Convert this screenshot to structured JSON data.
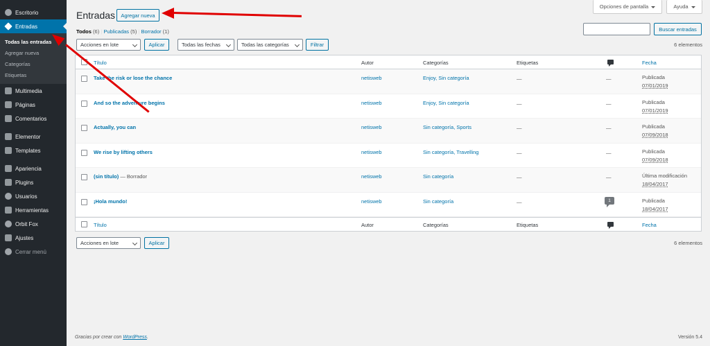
{
  "sidebar": {
    "items": [
      {
        "label": "Escritorio",
        "icon": "dashboard-icon"
      },
      {
        "label": "Entradas",
        "icon": "pin-icon",
        "active": true
      },
      {
        "label": "Multimedia",
        "icon": "media-icon"
      },
      {
        "label": "Páginas",
        "icon": "pages-icon"
      },
      {
        "label": "Comentarios",
        "icon": "comments-icon"
      },
      {
        "label": "Elementor",
        "icon": "elementor-icon"
      },
      {
        "label": "Templates",
        "icon": "templates-icon"
      },
      {
        "label": "Apariencia",
        "icon": "brush-icon"
      },
      {
        "label": "Plugins",
        "icon": "plugin-icon"
      },
      {
        "label": "Usuarios",
        "icon": "users-icon"
      },
      {
        "label": "Herramientas",
        "icon": "wrench-icon"
      },
      {
        "label": "Orbit Fox",
        "icon": "fox-icon"
      },
      {
        "label": "Ajustes",
        "icon": "settings-icon"
      },
      {
        "label": "Cerrar menú",
        "icon": "collapse-icon"
      }
    ],
    "submenu": [
      "Todas las entradas",
      "Agregar nueva",
      "Categorías",
      "Etiquetas"
    ]
  },
  "top": {
    "screen_options": "Opciones de pantalla",
    "help": "Ayuda"
  },
  "page": {
    "title": "Entradas",
    "add_new": "Agregar nueva"
  },
  "filters": {
    "all": "Todos",
    "all_count": "(6)",
    "published": "Publicadas",
    "published_count": "(5)",
    "draft": "Borrador",
    "draft_count": "(1)",
    "sep": "|"
  },
  "search": {
    "value": "",
    "button": "Buscar entradas"
  },
  "bulk": {
    "select": "Acciones en lote",
    "apply": "Aplicar"
  },
  "dates": {
    "select": "Todas las fechas"
  },
  "cats": {
    "select": "Todas las categorías"
  },
  "filter_button": "Filtrar",
  "count_label": "6 elementos",
  "columns": {
    "title": "Título",
    "author": "Autor",
    "categories": "Categorías",
    "tags": "Etiquetas",
    "date": "Fecha"
  },
  "rows": [
    {
      "title": "Take the risk or lose the chance",
      "suffix": "",
      "author": "netisweb",
      "categories": "Enjoy, Sin categoría",
      "tags": "—",
      "comments": "—",
      "status": "Publicada",
      "date": "07/01/2019"
    },
    {
      "title": "And so the adventure begins",
      "suffix": "",
      "author": "netisweb",
      "categories": "Enjoy, Sin categoría",
      "tags": "—",
      "comments": "—",
      "status": "Publicada",
      "date": "07/01/2019"
    },
    {
      "title": "Actually, you can",
      "suffix": "",
      "author": "netisweb",
      "categories": "Sin categoría, Sports",
      "tags": "—",
      "comments": "—",
      "status": "Publicada",
      "date": "07/09/2018"
    },
    {
      "title": "We rise by lifting others",
      "suffix": "",
      "author": "netisweb",
      "categories": "Sin categoría, Travelling",
      "tags": "—",
      "comments": "—",
      "status": "Publicada",
      "date": "07/09/2018"
    },
    {
      "title": "(sin título)",
      "suffix": " — Borrador",
      "author": "netisweb",
      "categories": "Sin categoría",
      "tags": "—",
      "comments": "—",
      "status": "Última modificación",
      "date": "18/04/2017"
    },
    {
      "title": "¡Hola mundo!",
      "suffix": "",
      "author": "netisweb",
      "categories": "Sin categoría",
      "tags": "—",
      "comments": "1",
      "status": "Publicada",
      "date": "18/04/2017"
    }
  ],
  "footer": {
    "thanks": "Gracias por crear con ",
    "wp": "WordPress",
    "dot": ".",
    "version": "Versión 5.4"
  },
  "colors": {
    "sidebar_bg": "#23282d",
    "accent": "#0073aa",
    "arrow": "#e00000"
  }
}
